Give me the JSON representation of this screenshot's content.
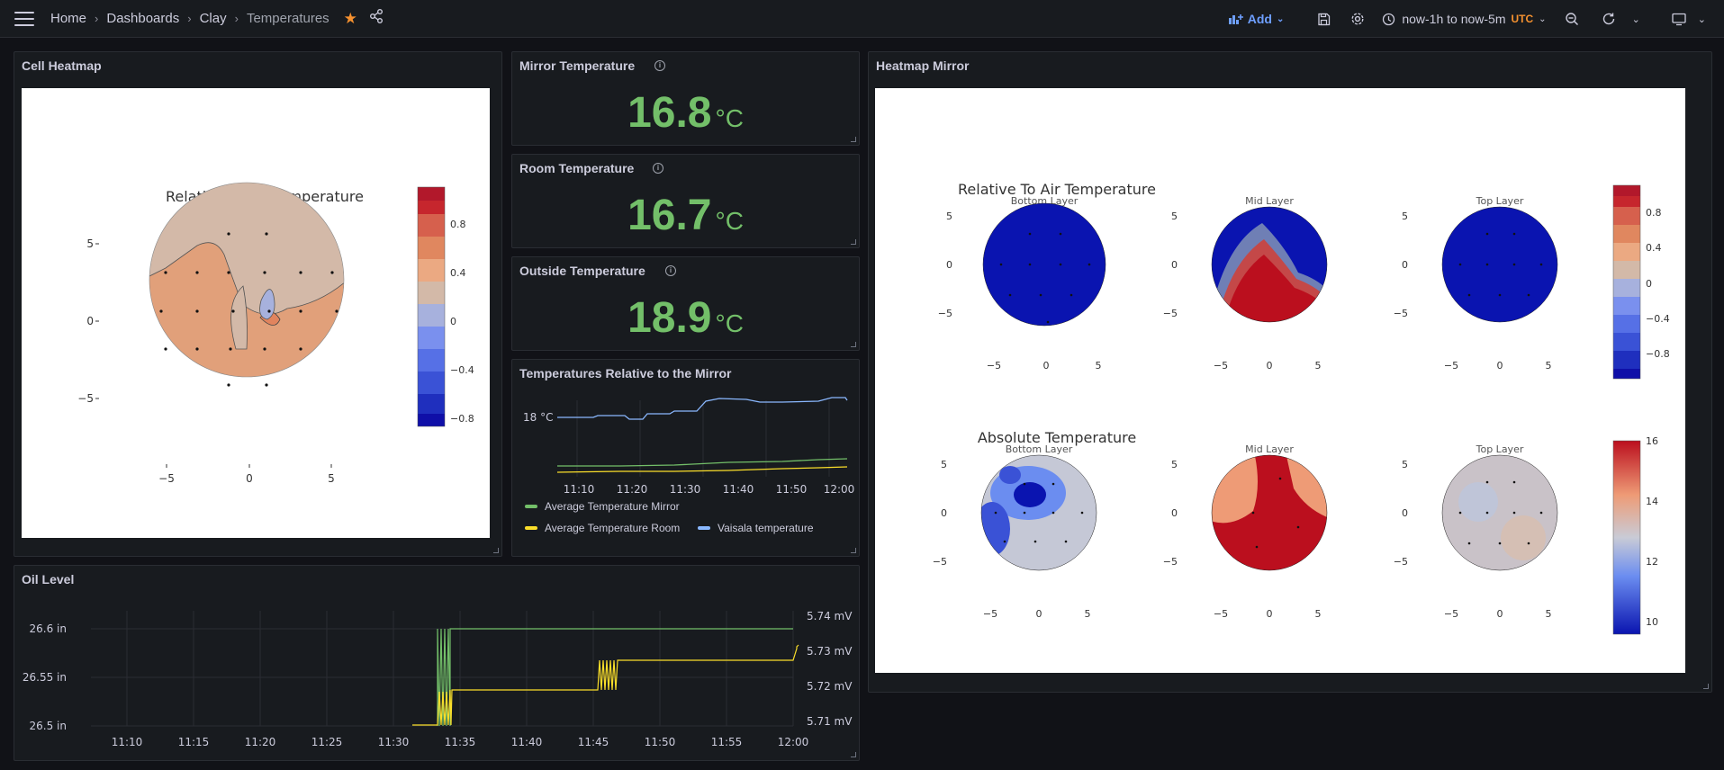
{
  "breadcrumb": [
    "Home",
    "Dashboards",
    "Clay",
    "Temperatures"
  ],
  "toolbar": {
    "add_label": "Add",
    "time_range": "now-1h to now-5m",
    "timezone": "UTC"
  },
  "panels": {
    "cell_heatmap": {
      "title": "Cell Heatmap",
      "plot_title": "Relative To Air Temperature",
      "y_ticks": [
        "5",
        "0",
        "−5"
      ],
      "x_ticks": [
        "−5",
        "0",
        "5"
      ],
      "colorbar_ticks": [
        "0.8",
        "0.4",
        "0",
        "−0.4",
        "−0.8"
      ]
    },
    "mirror": {
      "title": "Mirror Temperature",
      "value": "16.8",
      "unit": "°C"
    },
    "room": {
      "title": "Room Temperature",
      "value": "16.7",
      "unit": "°C"
    },
    "outside": {
      "title": "Outside Temperature",
      "value": "18.9",
      "unit": "°C"
    },
    "relative": {
      "title": "Temperatures Relative to the Mirror",
      "y_label": "18 °C",
      "x_ticks": [
        "11:10",
        "11:20",
        "11:30",
        "11:40",
        "11:50",
        "12:00"
      ],
      "legend": [
        "Average Temperature Mirror",
        "Average Temperature Room",
        "Vaisala temperature"
      ]
    },
    "heatmap_mirror": {
      "title": "Heatmap Mirror",
      "row1_title": "Relative To Air Temperature",
      "row2_title": "Absolute Temperature",
      "layers": [
        "Bottom Layer",
        "Mid Layer",
        "Top Layer"
      ],
      "y_ticks": [
        "5",
        "0",
        "−5"
      ],
      "x_ticks": [
        "−5",
        "0",
        "5"
      ],
      "colorbar1_ticks": [
        "0.8",
        "0.4",
        "0",
        "−0.4",
        "−0.8"
      ],
      "colorbar2_ticks": [
        "16",
        "14",
        "12",
        "10"
      ]
    },
    "oil": {
      "title": "Oil Level",
      "left_ticks": [
        "26.6 in",
        "26.55 in",
        "26.5 in"
      ],
      "right_ticks": [
        "5.74 mV",
        "5.73 mV",
        "5.72 mV",
        "5.71 mV"
      ],
      "x_ticks": [
        "11:10",
        "11:15",
        "11:20",
        "11:25",
        "11:30",
        "11:35",
        "11:40",
        "11:45",
        "11:50",
        "11:55",
        "12:00"
      ]
    }
  },
  "colors": {
    "stat_green": "#73bf69",
    "series_green": "#73bf69",
    "series_yellow": "#fade2a",
    "series_blue": "#8ab8ff",
    "accent_orange": "#f5912f",
    "link_blue": "#6e9fff"
  }
}
